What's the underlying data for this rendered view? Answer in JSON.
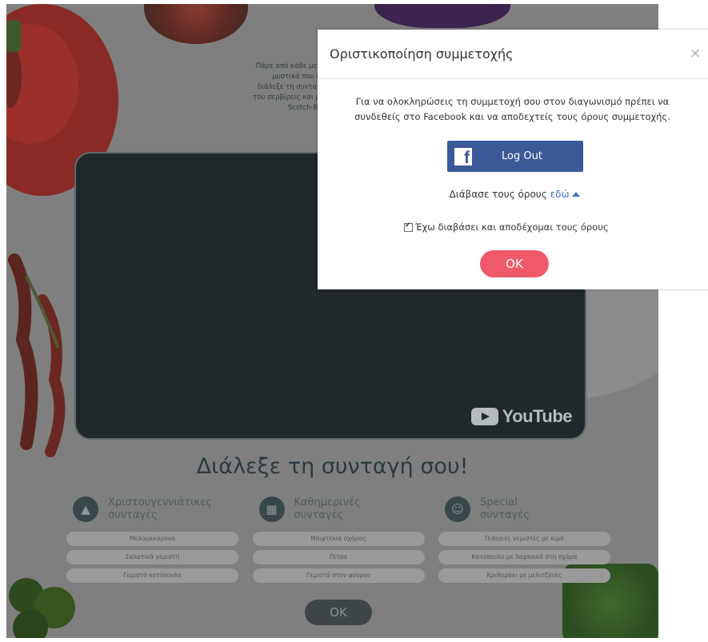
{
  "page": {
    "intro_lines": [
      "Πάρε από κάθε μεγάλο chef",
      "μυστικά που κερδίζουν",
      "διάλεξε τη συνταγή που θα",
      "του σερβίρεις και μπες στην",
      "Scotch-Brite™ που"
    ],
    "video": {
      "brand": "YouTube"
    },
    "choose_title": "Διάλεξε τη συνταγή σου!",
    "categories": [
      {
        "icon": "christmas-tree-icon",
        "title_lines": [
          "Χριστουγεννιάτικες",
          "συνταγές"
        ],
        "recipes": [
          "Μελομακάρονα",
          "Σαλατικά γεμιστή",
          "Γεμιστό κοτόπουλο"
        ]
      },
      {
        "icon": "calendar-icon",
        "title_lines": [
          "Καθημερινές",
          "συνταγές"
        ],
        "recipes": [
          "Μπιφτέκια σχάρας",
          "Πίτσα",
          "Γεμιστά στον φούρνο"
        ]
      },
      {
        "icon": "chef-icon",
        "title_lines": [
          "Special",
          "συνταγές"
        ],
        "recipes": [
          "Πιπεριές γεμιστές με κιμά",
          "Κοτόπουλο με λαχανικά στη σχάρα",
          "Κριθαράκι με μελιτζάνες"
        ]
      }
    ],
    "bottom_ok": "OK"
  },
  "modal": {
    "title": "Οριστικοποίηση συμμετοχής",
    "close_glyph": "×",
    "message_line1": "Για να ολοκληρώσεις τη συμμετοχή σου στον διαγωνισμό πρέπει να",
    "message_line2": "συνδεθείς στο Facebook και να αποδεχτείς τους όρους συμμετοχής.",
    "fb_icon_letter": "f",
    "fb_button_label": "Log Out",
    "terms_prefix": "Διάβασε τους όρους",
    "terms_link": "εδώ",
    "accept_label": "Έχω διαβάσει και αποδέχομαι τους όρους",
    "accept_checked": true,
    "ok_label": "OK"
  },
  "colors": {
    "facebook_blue": "#3b5998",
    "ok_pink": "#ef5a6a",
    "link_blue": "#3a6fc4",
    "overlay_gray": "#7f7f7f"
  }
}
